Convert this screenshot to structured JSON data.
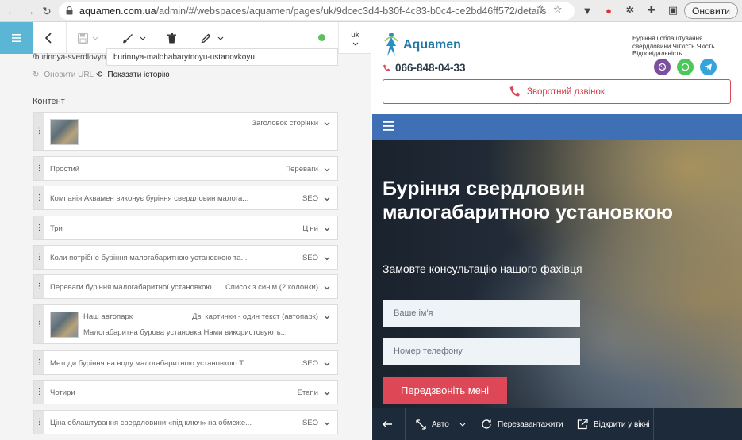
{
  "browser": {
    "address": {
      "domain": "aquamen.com.ua",
      "path": "/admin/#/webspaces/aquamen/pages/uk/9dcec3d4-b30f-4c83-b0c4-ce2bd46ff572/details"
    },
    "update_label": "Оновити"
  },
  "toolbar": {
    "language": "uk",
    "status_color": "#5cc15c"
  },
  "url": {
    "prefix": "/burinnya-sverdlovyn/",
    "value": "burinnya-malohabarytnoyu-ustanovkoyu",
    "refresh_label": "Оновити URL",
    "history_label": "Показати історію"
  },
  "content_label": "Контент",
  "blocks": [
    {
      "title": "",
      "type": "Заголовок сторінки",
      "has_image": true
    },
    {
      "title": "Простий",
      "type": "Переваги"
    },
    {
      "title": "Компанія Аквамен виконує буріння свердловин малога...",
      "type": "SEO"
    },
    {
      "title": "Три",
      "type": "Ціни"
    },
    {
      "title": "Коли потрібне буріння малогабаритною установкою та...",
      "type": "SEO"
    },
    {
      "title": "Переваги буріння малогабаритної установкою",
      "type": "Список з синім (2 колонки)"
    },
    {
      "title": "Наш автопарк",
      "type": "Дві картинки - один текст (автопарк)",
      "subtitle": "Малогабаритна бурова установка Нами використовують...",
      "has_image": true
    },
    {
      "title": "Методи буріння на воду малогабаритною установкою Т...",
      "type": "SEO"
    },
    {
      "title": "Чотири",
      "type": "Етапи"
    },
    {
      "title": "Ціна облаштування свердловини «під ключ» на обмеже...",
      "type": "SEO"
    }
  ],
  "site": {
    "brand": "Aquamen",
    "tagline": "Буріння і облаштування свердловини Чіткість Якість Відповідальність",
    "phone": "066-848-04-33",
    "callback_label": "Зворотний дзвінок",
    "hero_title": "Буріння свердловин малогабаритною установкою",
    "hero_subtitle": "Замовте консультацію нашого фахівця",
    "name_placeholder": "Ваше ім'я",
    "phone_placeholder": "Номер телефону",
    "submit_label": "Передзвоніть мені",
    "colors": {
      "brand_blue": "#1f78a8",
      "nav_blue": "#3f6fb5",
      "accent_red": "#de4755",
      "viber": "#7b519d",
      "whatsapp": "#4cc75a",
      "telegram": "#35a4d9"
    }
  },
  "preview_bar": {
    "device_label": "Авто",
    "reload_label": "Перезавантажити",
    "open_label": "Відкрити у вікні"
  }
}
